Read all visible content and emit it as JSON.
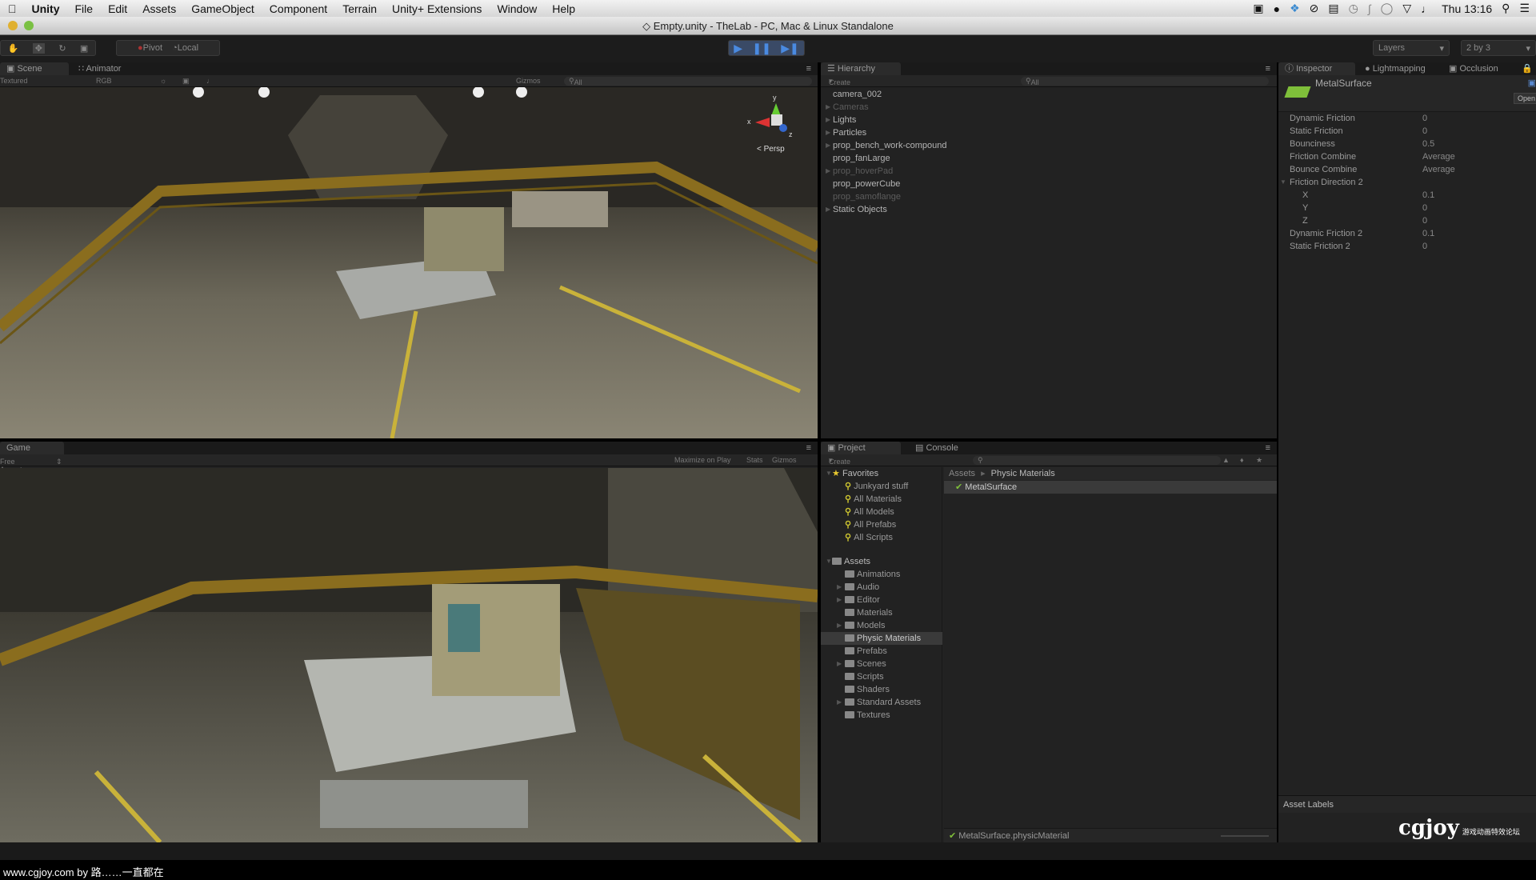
{
  "menubar": {
    "app": "Unity",
    "items": [
      "File",
      "Edit",
      "Assets",
      "GameObject",
      "Component",
      "Terrain",
      "Unity+ Extensions",
      "Window",
      "Help"
    ],
    "clock": "Thu 13:16"
  },
  "window": {
    "title": "Empty.unity - TheLab - PC, Mac & Linux Standalone"
  },
  "toolbar": {
    "pivot": "Pivot",
    "local": "Local",
    "layers": "Layers",
    "layout": "2 by 3"
  },
  "scene": {
    "tabs": [
      "Scene",
      "Animator"
    ],
    "shading": "Textured",
    "render_mode": "RGB",
    "gizmos": "Gizmos",
    "search": "All",
    "persp": "Persp",
    "axis_x": "x",
    "axis_y": "y",
    "axis_z": "z"
  },
  "game": {
    "tab": "Game",
    "aspect": "Free Aspect",
    "maximize": "Maximize on Play",
    "stats": "Stats",
    "gizmos": "Gizmos"
  },
  "hierarchy": {
    "tab": "Hierarchy",
    "create": "Create",
    "search": "All",
    "items": [
      {
        "label": "camera_002",
        "expandable": false,
        "dim": false
      },
      {
        "label": "Cameras",
        "expandable": true,
        "dim": true
      },
      {
        "label": "Lights",
        "expandable": true,
        "dim": false
      },
      {
        "label": "Particles",
        "expandable": true,
        "dim": false
      },
      {
        "label": "prop_bench_work-compound",
        "expandable": true,
        "dim": false
      },
      {
        "label": "prop_fanLarge",
        "expandable": false,
        "dim": false
      },
      {
        "label": "prop_hoverPad",
        "expandable": true,
        "dim": true
      },
      {
        "label": "prop_powerCube",
        "expandable": false,
        "dim": false
      },
      {
        "label": "prop_samoflange",
        "expandable": false,
        "dim": true
      },
      {
        "label": "Static Objects",
        "expandable": true,
        "dim": false
      }
    ]
  },
  "inspector": {
    "tabs": [
      "Inspector",
      "Lightmapping",
      "Occlusion"
    ],
    "object_name": "MetalSurface",
    "open_button": "Open",
    "properties": [
      {
        "label": "Dynamic Friction",
        "value": "0",
        "indent": false
      },
      {
        "label": "Static Friction",
        "value": "0",
        "indent": false
      },
      {
        "label": "Bounciness",
        "value": "0.5",
        "indent": false
      },
      {
        "label": "Friction Combine",
        "value": "Average",
        "indent": false
      },
      {
        "label": "Bounce Combine",
        "value": "Average",
        "indent": false
      },
      {
        "label": "Friction Direction 2",
        "value": "",
        "indent": false
      },
      {
        "label": "X",
        "value": "0.1",
        "indent": true
      },
      {
        "label": "Y",
        "value": "0",
        "indent": true
      },
      {
        "label": "Z",
        "value": "0",
        "indent": true
      },
      {
        "label": "Dynamic Friction 2",
        "value": "0.1",
        "indent": false
      },
      {
        "label": "Static Friction 2",
        "value": "0",
        "indent": false
      }
    ],
    "asset_labels": "Asset Labels"
  },
  "project": {
    "tabs": [
      "Project",
      "Console"
    ],
    "create": "Create",
    "favorites_label": "Favorites",
    "favorites": [
      "Junkyard stuff",
      "All Materials",
      "All Models",
      "All Prefabs",
      "All Scripts"
    ],
    "assets_label": "Assets",
    "folders": [
      {
        "label": "Animations",
        "expandable": false
      },
      {
        "label": "Audio",
        "expandable": true
      },
      {
        "label": "Editor",
        "expandable": true
      },
      {
        "label": "Materials",
        "expandable": false
      },
      {
        "label": "Models",
        "expandable": true
      },
      {
        "label": "Physic Materials",
        "expandable": false,
        "selected": true
      },
      {
        "label": "Prefabs",
        "expandable": false
      },
      {
        "label": "Scenes",
        "expandable": true
      },
      {
        "label": "Scripts",
        "expandable": false
      },
      {
        "label": "Shaders",
        "expandable": false
      },
      {
        "label": "Standard Assets",
        "expandable": true
      },
      {
        "label": "Textures",
        "expandable": false
      }
    ],
    "breadcrumb": [
      "Assets",
      "Physic Materials"
    ],
    "files": [
      "MetalSurface"
    ],
    "selected_path": "MetalSurface.physicMaterial"
  },
  "watermark": {
    "logo": "cgjoy",
    "caption": "www.cgjoy.com by 路……一直都在"
  },
  "colors": {
    "accent_play": "#3d6fb5",
    "material_green": "#7fbf3a",
    "panel": "#222222",
    "menubar": "#e0e0e0"
  }
}
